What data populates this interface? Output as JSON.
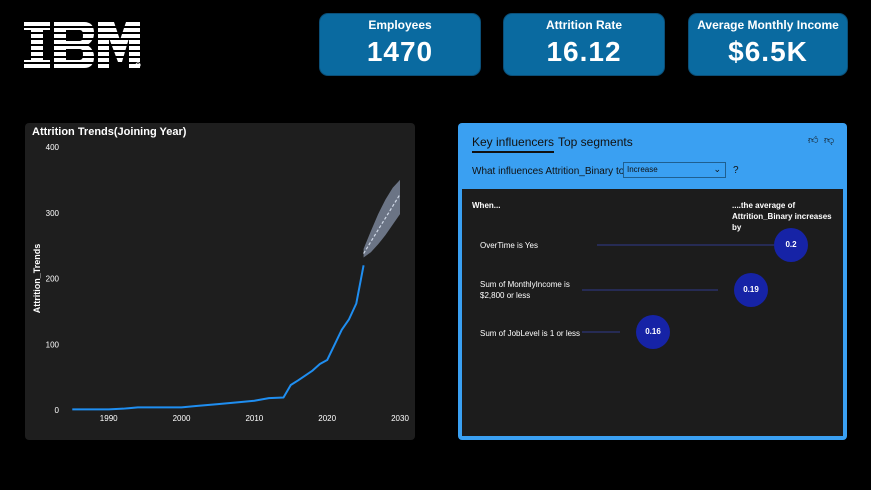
{
  "logo": {
    "text": "IBM"
  },
  "kpis": [
    {
      "label": "Employees",
      "value": "1470"
    },
    {
      "label": "Attrition Rate",
      "value": "16.12"
    },
    {
      "label": "Average Monthly Income",
      "value": "$6.5K"
    }
  ],
  "chart_data": {
    "type": "line",
    "title": "Attrition Trends(Joining Year)",
    "xlabel": "",
    "ylabel": "Attrition_Trends",
    "xlim": [
      1984,
      2030
    ],
    "ylim": [
      0,
      400
    ],
    "x_ticks": [
      "1990",
      "2000",
      "2010",
      "2020",
      "2030"
    ],
    "y_ticks": [
      "0",
      "100",
      "200",
      "300",
      "400"
    ],
    "series": [
      {
        "x": [
          1985,
          1990,
          1992,
          1994,
          1997,
          2000,
          2002,
          2005,
          2008,
          2010,
          2012,
          2014,
          2015,
          2016,
          2018,
          2019,
          2020,
          2022,
          2023,
          2024,
          2025
        ],
        "values": [
          1,
          1,
          2,
          4,
          4,
          4,
          6,
          9,
          12,
          14,
          18,
          19,
          38,
          45,
          60,
          70,
          76,
          122,
          138,
          162,
          220
        ]
      }
    ],
    "forecast": {
      "x": [
        2025,
        2026,
        2027,
        2028,
        2029,
        2030
      ],
      "values": [
        238,
        256,
        274,
        292,
        310,
        328
      ],
      "upper": [
        245,
        272,
        298,
        320,
        338,
        350
      ],
      "lower": [
        232,
        240,
        252,
        266,
        282,
        298
      ]
    },
    "colors": {
      "line": "#1f8ef1",
      "band": "#8592a8",
      "forecast": "#cfd8e6"
    }
  },
  "key_influencers": {
    "tabs": [
      "Key influencers",
      "Top segments"
    ],
    "question": "What influences Attrition_Binary to",
    "dropdown_value": "Increase",
    "question_mark": "?",
    "when_header": "When...",
    "avg_header": [
      "....the average of",
      "Attrition_Binary increases by"
    ],
    "factors": [
      {
        "lines": [
          "OverTime is Yes"
        ],
        "value": "0.2"
      },
      {
        "lines": [
          "Sum of MonthlyIncome is",
          "$2,800 or less"
        ],
        "value": "0.19"
      },
      {
        "lines": [
          "Sum of JobLevel is 1 or less"
        ],
        "value": "0.16"
      }
    ]
  }
}
